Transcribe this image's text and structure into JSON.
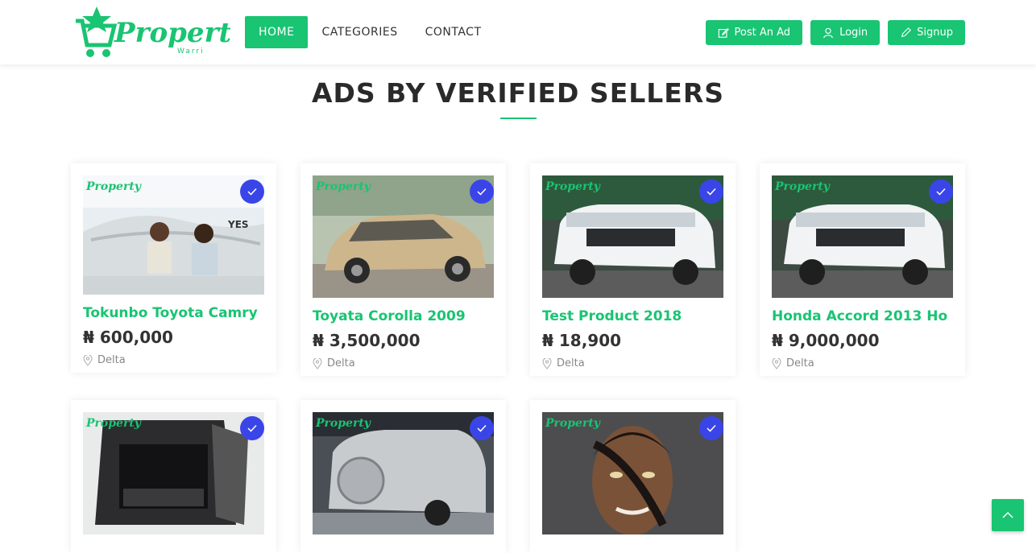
{
  "brand": {
    "logo_text": "Property",
    "logo_sub": "Warri",
    "accent": "#19c472",
    "verify_color": "#3a45e8"
  },
  "nav": {
    "home": "HOME",
    "categories": "CATEGORIES",
    "contact": "CONTACT"
  },
  "actions": {
    "post_ad": "Post An Ad",
    "login": "Login",
    "signup": "Signup"
  },
  "section": {
    "title": "ADS BY VERIFIED SELLERS"
  },
  "listings": [
    {
      "title": "Tokunbo Toyota Camry",
      "price": "₦ 600,000",
      "location": "Delta",
      "image": "boat-couple-photo"
    },
    {
      "title": "Toyata Corolla 2009",
      "price": "₦ 3,500,000",
      "location": "Delta",
      "image": "gold-sedan-photo"
    },
    {
      "title": "Test Product 2018",
      "price": "₦ 18,900",
      "location": "Delta",
      "image": "white-suv-photo"
    },
    {
      "title": "Honda Accord 2013 Ho",
      "price": "₦ 9,000,000",
      "location": "Delta",
      "image": "white-suv-photo"
    },
    {
      "title": "",
      "price": "",
      "location": "",
      "image": "suv-trunk-photo"
    },
    {
      "title": "",
      "price": "",
      "location": "",
      "image": "silver-suv-photo"
    },
    {
      "title": "",
      "price": "",
      "location": "",
      "image": "3d-face-photo"
    }
  ]
}
